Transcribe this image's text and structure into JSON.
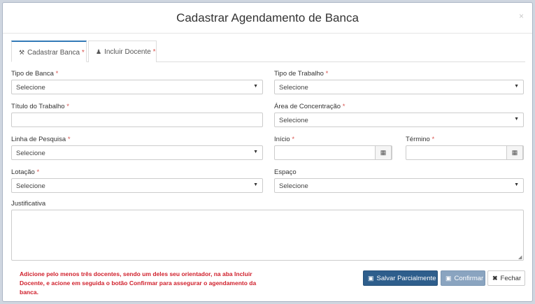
{
  "modal": {
    "title": "Cadastrar Agendamento de Banca",
    "close_label": "×"
  },
  "tabs": [
    {
      "label": "Cadastrar Banca",
      "required_mark": "*",
      "icon": "gavel-icon"
    },
    {
      "label": "Incluir Docente",
      "required_mark": "*",
      "icon": "user-icon"
    }
  ],
  "form": {
    "tipo_banca": {
      "label": "Tipo de Banca",
      "required": "*",
      "value": "Selecione"
    },
    "tipo_trabalho": {
      "label": "Tipo de Trabalho",
      "required": "*",
      "value": "Selecione"
    },
    "titulo_trabalho": {
      "label": "Título do Trabalho",
      "required": "*",
      "value": ""
    },
    "area_concentracao": {
      "label": "Área de Concentração",
      "required": "*",
      "value": "Selecione"
    },
    "linha_pesquisa": {
      "label": "Linha de Pesquisa",
      "required": "*",
      "value": "Selecione"
    },
    "inicio": {
      "label": "Início",
      "required": "*",
      "value": ""
    },
    "termino": {
      "label": "Término",
      "required": "*",
      "value": ""
    },
    "lotacao": {
      "label": "Lotação",
      "required": "*",
      "value": "Selecione"
    },
    "espaco": {
      "label": "Espaço",
      "value": "Selecione"
    },
    "justificativa": {
      "label": "Justificativa",
      "value": ""
    }
  },
  "footer": {
    "warning": "Adicione pelo menos três docentes, sendo um deles seu orientador, na aba Incluir Docente, e acione em seguida o botão Confirmar para assegurar o agendamento da banca.",
    "save_partial": "Salvar Parcialmente",
    "confirm": "Confirmar",
    "close": "Fechar"
  },
  "colors": {
    "primary": "#2e5e8c",
    "required": "#d9534f",
    "warning": "#d0202c",
    "tab_accent": "#337ab7"
  }
}
